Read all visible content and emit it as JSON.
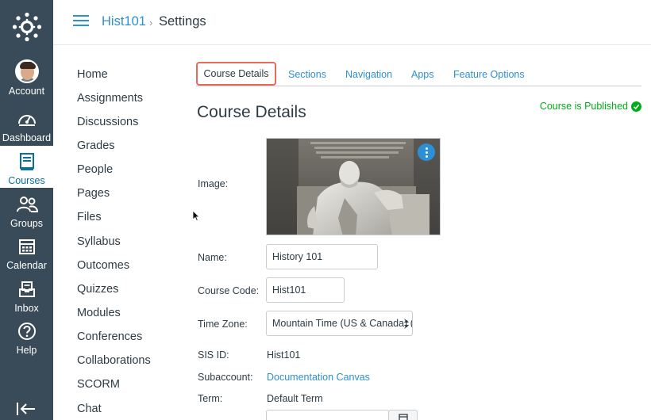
{
  "global_nav": {
    "items": [
      {
        "label": "Account",
        "icon": "avatar"
      },
      {
        "label": "Dashboard",
        "icon": "dashboard-icon"
      },
      {
        "label": "Courses",
        "icon": "courses-icon",
        "active": true
      },
      {
        "label": "Groups",
        "icon": "groups-icon"
      },
      {
        "label": "Calendar",
        "icon": "calendar-icon"
      },
      {
        "label": "Inbox",
        "icon": "inbox-icon"
      },
      {
        "label": "Help",
        "icon": "help-icon"
      }
    ],
    "colors": {
      "background": "#394b58",
      "active_text": "#0770a3"
    }
  },
  "header": {
    "course": "Hist101",
    "separator": "›",
    "current": "Settings"
  },
  "course_nav": {
    "items": [
      "Home",
      "Assignments",
      "Discussions",
      "Grades",
      "People",
      "Pages",
      "Files",
      "Syllabus",
      "Outcomes",
      "Quizzes",
      "Modules",
      "Conferences",
      "Collaborations",
      "SCORM",
      "Chat"
    ]
  },
  "tabs": [
    "Course Details",
    "Sections",
    "Navigation",
    "Apps",
    "Feature Options"
  ],
  "page": {
    "title": "Course Details",
    "status": "Course is Published"
  },
  "form": {
    "image_label": "Image:",
    "name_label": "Name:",
    "name_value": "History 101",
    "code_label": "Course Code:",
    "code_value": "Hist101",
    "timezone_label": "Time Zone:",
    "timezone_value": "Mountain Time (US & Canada) (-",
    "sis_label": "SIS ID:",
    "sis_value": "Hist101",
    "subaccount_label": "Subaccount:",
    "subaccount_value": "Documentation Canvas",
    "term_label": "Term:",
    "term_value": "Default Term"
  },
  "colors": {
    "link": "#2d8fd5",
    "published": "#00ac18",
    "active_tab_border": "#e66a5a"
  }
}
